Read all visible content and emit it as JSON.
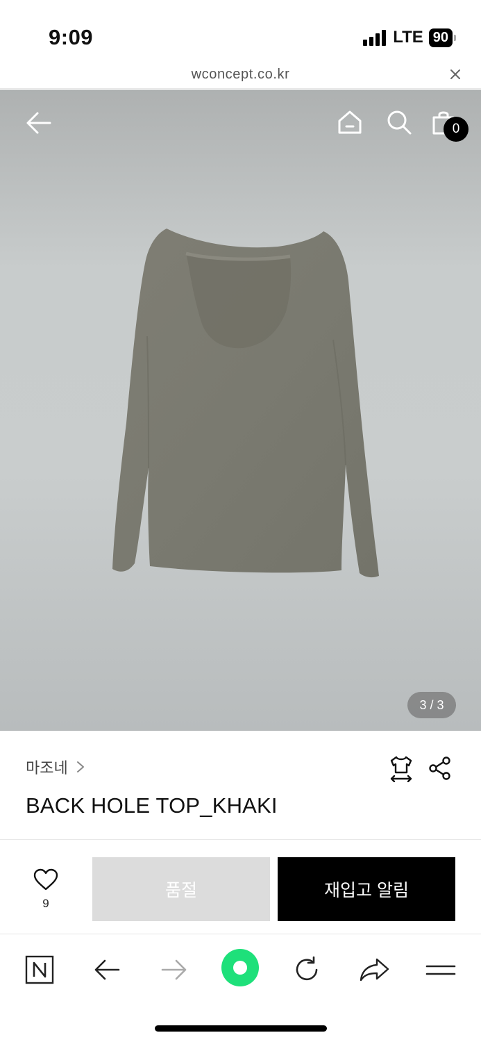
{
  "status": {
    "time": "9:09",
    "network": "LTE",
    "battery": "90"
  },
  "browser": {
    "url": "wconcept.co.kr"
  },
  "header": {
    "cart_count": "0"
  },
  "gallery": {
    "pager": "3 / 3"
  },
  "product": {
    "brand": "마조네",
    "title": "BACK HOLE TOP_KHAKI",
    "like_count": "9",
    "soldout_label": "품절",
    "restock_label": "재입고 알림"
  },
  "colors": {
    "accent": "#000000",
    "soldout_bg": "#dcdcdc",
    "refresh_green": "#1ee07a"
  }
}
